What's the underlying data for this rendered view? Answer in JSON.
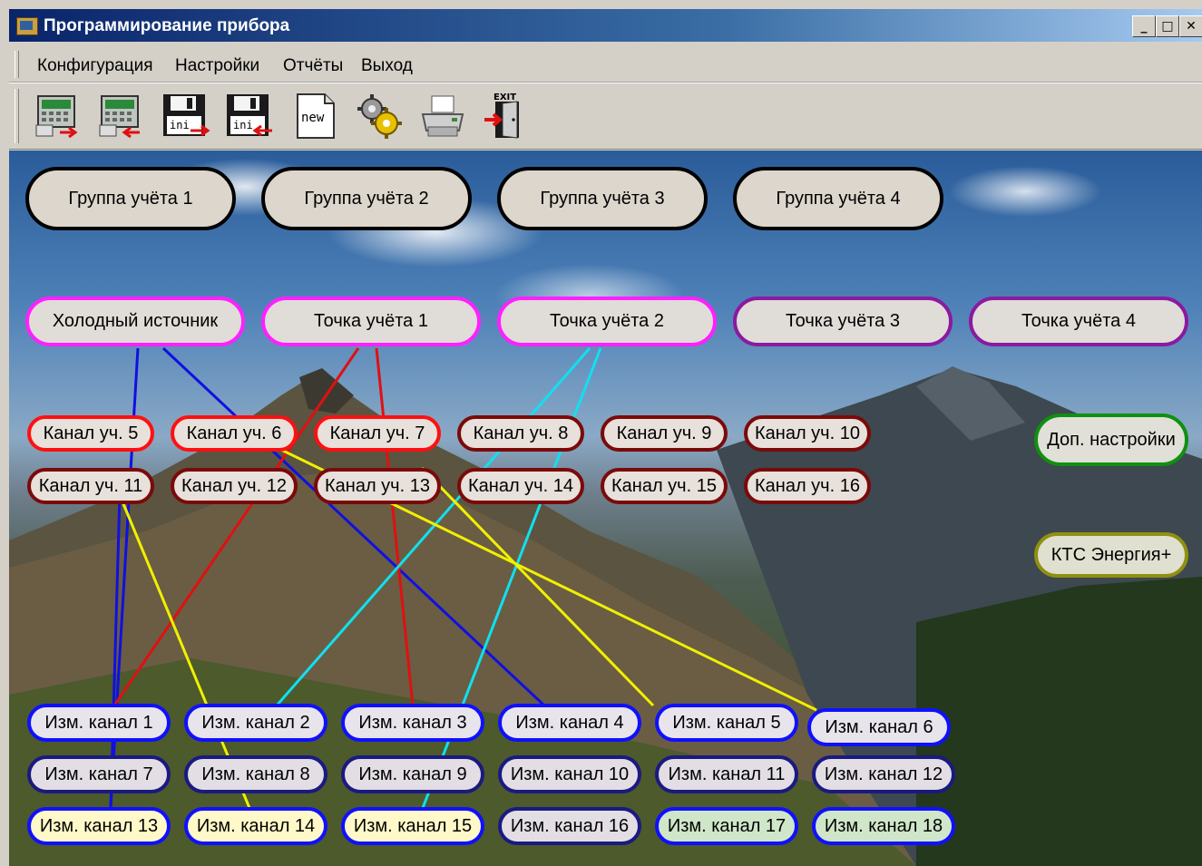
{
  "window": {
    "title": "Программирование прибора"
  },
  "window_buttons": {
    "minimize": "_",
    "maximize": "□",
    "close": "✕"
  },
  "menu": [
    "Конфигурация",
    "Настройки",
    "Отчёты",
    "Выход"
  ],
  "toolbar": {
    "icons": [
      "read-device-icon",
      "write-device-icon",
      "save-ini-icon",
      "load-ini-icon",
      "new-document-icon",
      "settings-gears-icon",
      "print-icon",
      "exit-door-icon"
    ],
    "new_label": "new",
    "ini_label": "ini",
    "exit_label": "EXIT"
  },
  "groups": [
    "Группа учёта 1",
    "Группа учёта 2",
    "Группа учёта 3",
    "Группа учёта 4"
  ],
  "points": [
    "Холодный источник",
    "Точка учёта 1",
    "Точка учёта 2",
    "Точка учёта 3",
    "Точка учёта 4"
  ],
  "channels_row1": [
    "Канал уч. 5",
    "Канал уч. 6",
    "Канал уч. 7",
    "Канал уч. 8",
    "Канал уч. 9",
    "Канал уч. 10"
  ],
  "channels_row2": [
    "Канал уч. 11",
    "Канал уч. 12",
    "Канал уч. 13",
    "Канал уч. 14",
    "Канал уч. 15",
    "Канал уч. 16"
  ],
  "side": {
    "extra_settings": "Доп. настройки",
    "kts": "КТС Энергия+"
  },
  "measurement_channels": [
    [
      "Изм. канал 1",
      "Изм. канал 2",
      "Изм. канал 3",
      "Изм. канал 4",
      "Изм. канал 5",
      "Изм. канал 6"
    ],
    [
      "Изм. канал 7",
      "Изм. канал 8",
      "Изм. канал 9",
      "Изм. канал 10",
      "Изм. канал 11",
      "Изм. канал 12"
    ],
    [
      "Изм. канал 13",
      "Изм. канал 14",
      "Изм. канал 15",
      "Изм. канал 16",
      "Изм. канал 17",
      "Изм. канал 18"
    ]
  ],
  "link_colors": {
    "blue": "#1010e0",
    "red": "#e01010",
    "yellow": "#f0f000",
    "cyan": "#10e0f0"
  }
}
